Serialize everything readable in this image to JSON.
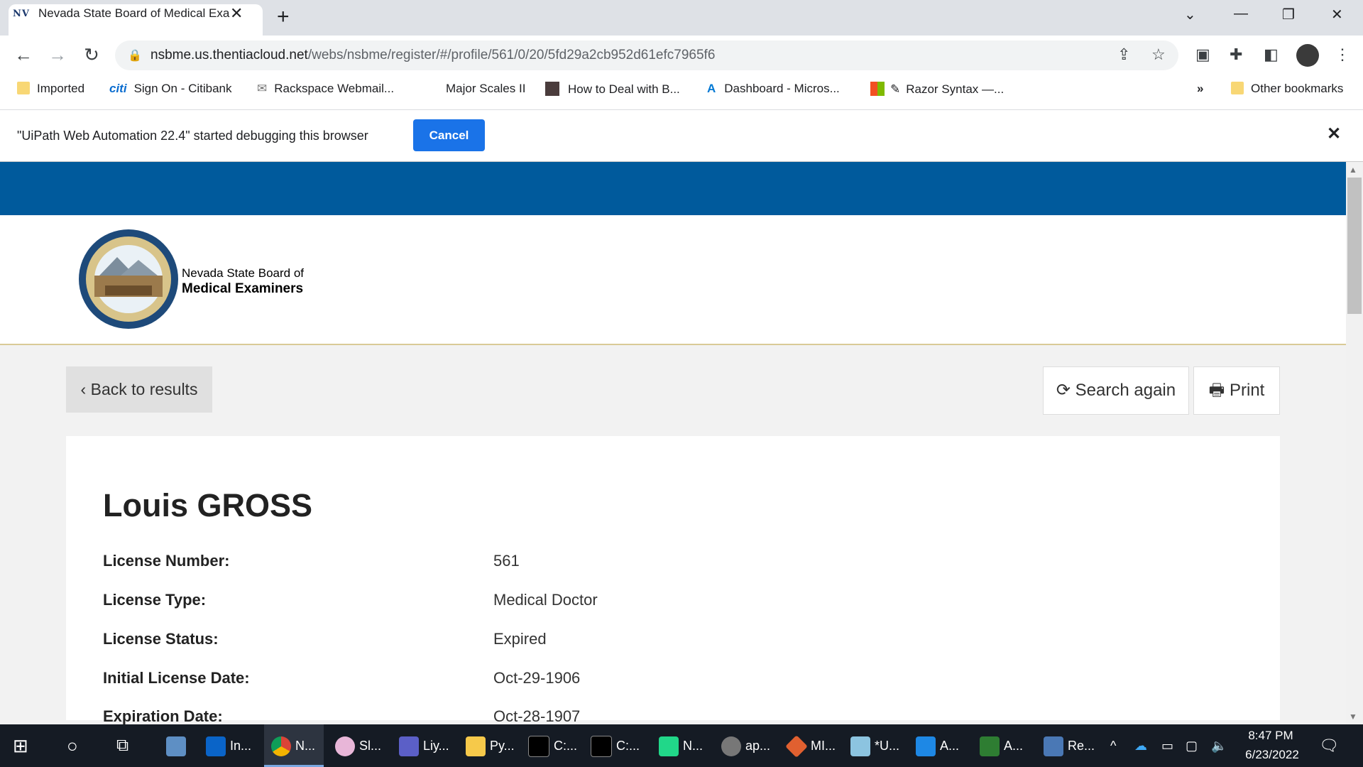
{
  "browser": {
    "tab": {
      "favicon_text": "NV",
      "title": "Nevada State Board of Medical Examiners"
    },
    "url": {
      "host": "nsbme.us.thentiacloud.net",
      "path": "/webs/nsbme/register/#/profile/561/0/20/5fd29a2cb952d61efc7965f6"
    },
    "bookmarks": [
      "Imported",
      "Sign On - Citibank",
      "Rackspace Webmail...",
      "Major Scales II",
      "How to Deal with B...",
      "Dashboard - Micros...",
      "Razor Syntax —...",
      "»",
      "Other bookmarks"
    ],
    "infobar": {
      "message": "\"UiPath Web Automation 22.4\" started debugging this browser",
      "cancel_label": "Cancel"
    }
  },
  "page": {
    "brand_line1": "Nevada State Board of",
    "brand_line2": "Medical Examiners",
    "back_label": "Back to results",
    "search_again_label": "Search again",
    "print_label": "Print",
    "name": "Louis GROSS",
    "fields": [
      {
        "label": "License Number:",
        "value": "561"
      },
      {
        "label": "License Type:",
        "value": "Medical Doctor"
      },
      {
        "label": "License Status:",
        "value": "Expired"
      },
      {
        "label": "Initial License Date:",
        "value": "Oct-29-1906"
      },
      {
        "label": "Expiration Date:",
        "value": "Oct-28-1907"
      }
    ]
  },
  "taskbar": {
    "items": [
      "In...",
      "N...",
      "Sl...",
      "Liy...",
      "Py...",
      "C:...",
      "C:...",
      "N...",
      "ap...",
      "MI...",
      "*U...",
      "A...",
      "A...",
      "Re..."
    ],
    "time": "8:47 PM",
    "date": "6/23/2022"
  },
  "colors": {
    "header_blue": "#005a9c",
    "cancel_blue": "#1a73e8",
    "taskbar": "#151b24"
  }
}
